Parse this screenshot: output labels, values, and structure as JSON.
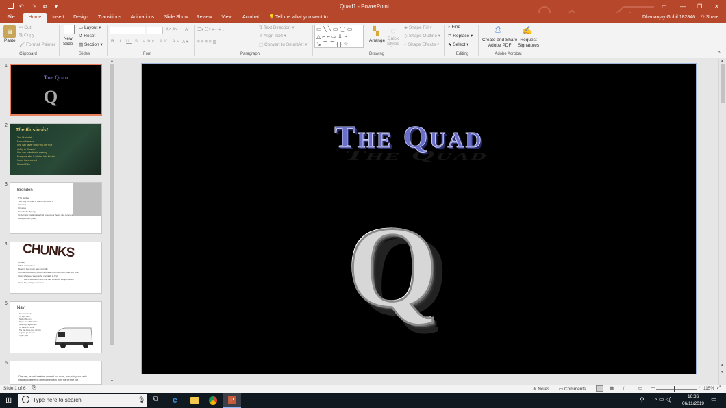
{
  "window": {
    "title": "Quad1 - PowerPoint",
    "user": "Dhananjay Gohil 182846",
    "share": "Share"
  },
  "tabs": [
    "File",
    "Home",
    "Insert",
    "Design",
    "Transitions",
    "Animations",
    "Slide Show",
    "Review",
    "View",
    "Acrobat"
  ],
  "tell_me": "Tell me what you want to do...",
  "ribbon": {
    "clipboard": {
      "paste": "Paste",
      "cut": "Cut",
      "copy": "Copy",
      "format_painter": "Format Painter",
      "label": "Clipboard"
    },
    "slides": {
      "new_slide": "New",
      "new_slide2": "Slide",
      "layout": "Layout",
      "reset": "Reset",
      "section": "Section",
      "label": "Slides"
    },
    "font": {
      "label": "Font"
    },
    "paragraph": {
      "text_direction": "Text Direction",
      "align_text": "Align Text",
      "convert": "Convert to SmartArt",
      "label": "Paragraph"
    },
    "drawing": {
      "arrange": "Arrange",
      "quick": "Quick",
      "styles": "Styles",
      "shape_fill": "Shape Fill",
      "shape_outline": "Shape Outline",
      "shape_effects": "Shape Effects",
      "label": "Drawing"
    },
    "editing": {
      "find": "Find",
      "replace": "Replace",
      "select": "Select",
      "label": "Editing"
    },
    "acrobat": {
      "create1": "Create and Share",
      "create2": "Adobe PDF",
      "request1": "Request",
      "request2": "Signatures",
      "label": "Adobe Acrobat"
    }
  },
  "thumbnails": [
    {
      "num": "1",
      "title": "The Quad"
    },
    {
      "num": "2",
      "title": "The Illusionist",
      "lines": [
        "The Illusionist",
        "Born in Nevada",
        "She can never show you her true",
        "ability to \"Illusion\"",
        "She can outwitter in anyway",
        "Everyone else is hidden into illusion",
        "Some have control",
        "Mutant Tribe"
      ]
    },
    {
      "num": "3",
      "title": "Brenden",
      "lines": [
        "The Hacker",
        "\"He may not start it, but he will finish it\"",
        "Inventor",
        "Creative",
        "Knowledge Sponge",
        "Cybernetic implant attached around our fleeks into our eyes",
        "Always Lose (Dad)"
      ]
    },
    {
      "num": "4",
      "title": "CHUNKS",
      "lines": [
        "Chunky",
        "Thick ammunition",
        "Doesn't feel much pain normally",
        "Can withstand from people and affect but it can still meet fine time",
        "Uses whatever weapon he can grab at first",
        "Has a device on wrist that can construct weapon at will",
        "Head first, always comes in"
      ]
    },
    {
      "num": "5",
      "title": "Nav",
      "lines": [
        "Nav is the leader",
        "He says much",
        "Soldier, 8th gen",
        "Maybe an ex 8th soldier",
        "Always got a good plan",
        "He was a first driver",
        "The van has a good carrying",
        "Logo for get all done",
        "Hyper Spirit"
      ]
    },
    {
      "num": "6",
      "lines": [
        "One day, as well-weather entered our room, in a policy, our table headed together to defend the class from the terrible foe."
      ]
    }
  ],
  "slide": {
    "title": "The Quad",
    "logo_letter": "Q"
  },
  "status": {
    "slide": "Slide 1 of 6",
    "notes": "Notes",
    "comments": "Comments",
    "zoom": "115%"
  },
  "taskbar": {
    "search": "Type here to search",
    "time": "16:36",
    "date": "06/11/2019"
  },
  "colors": {
    "accent": "#b7472a",
    "title_text": "#6a6fc8",
    "taskbar": "#101820"
  }
}
